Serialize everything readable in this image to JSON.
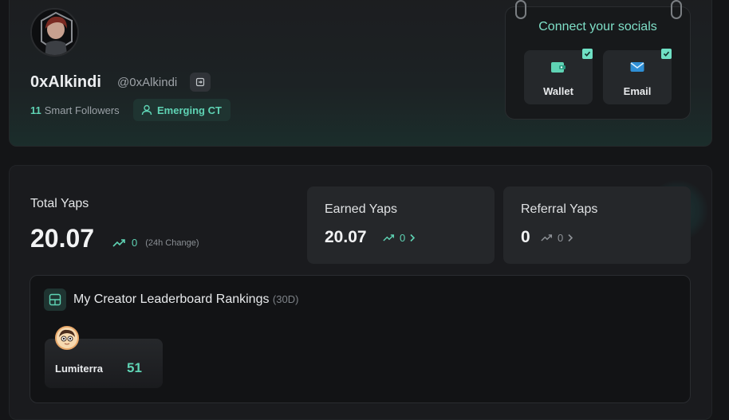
{
  "profile": {
    "display_name": "0xAlkindi",
    "handle": "@0xAlkindi",
    "smart_followers_count": "11",
    "smart_followers_label": "Smart Followers",
    "badge": "Emerging CT"
  },
  "socials": {
    "title": "Connect your socials",
    "items": [
      {
        "label": "Wallet",
        "icon": "wallet-icon",
        "connected": true
      },
      {
        "label": "Email",
        "icon": "email-icon",
        "connected": true
      }
    ]
  },
  "stats": {
    "total_label": "Total Yaps",
    "total_value": "20.07",
    "total_change": "0",
    "total_change_note": "(24h Change)",
    "earned_label": "Earned Yaps",
    "earned_value": "20.07",
    "earned_change": "0",
    "referral_label": "Referral Yaps",
    "referral_value": "0",
    "referral_change": "0"
  },
  "leaderboard": {
    "title": "My Creator Leaderboard Rankings",
    "period": "(30D)",
    "rankings": [
      {
        "name": "Lumiterra",
        "rank": "51"
      }
    ]
  },
  "colors": {
    "accent": "#5fd3b4",
    "background": "#141517",
    "card": "#25272a"
  }
}
